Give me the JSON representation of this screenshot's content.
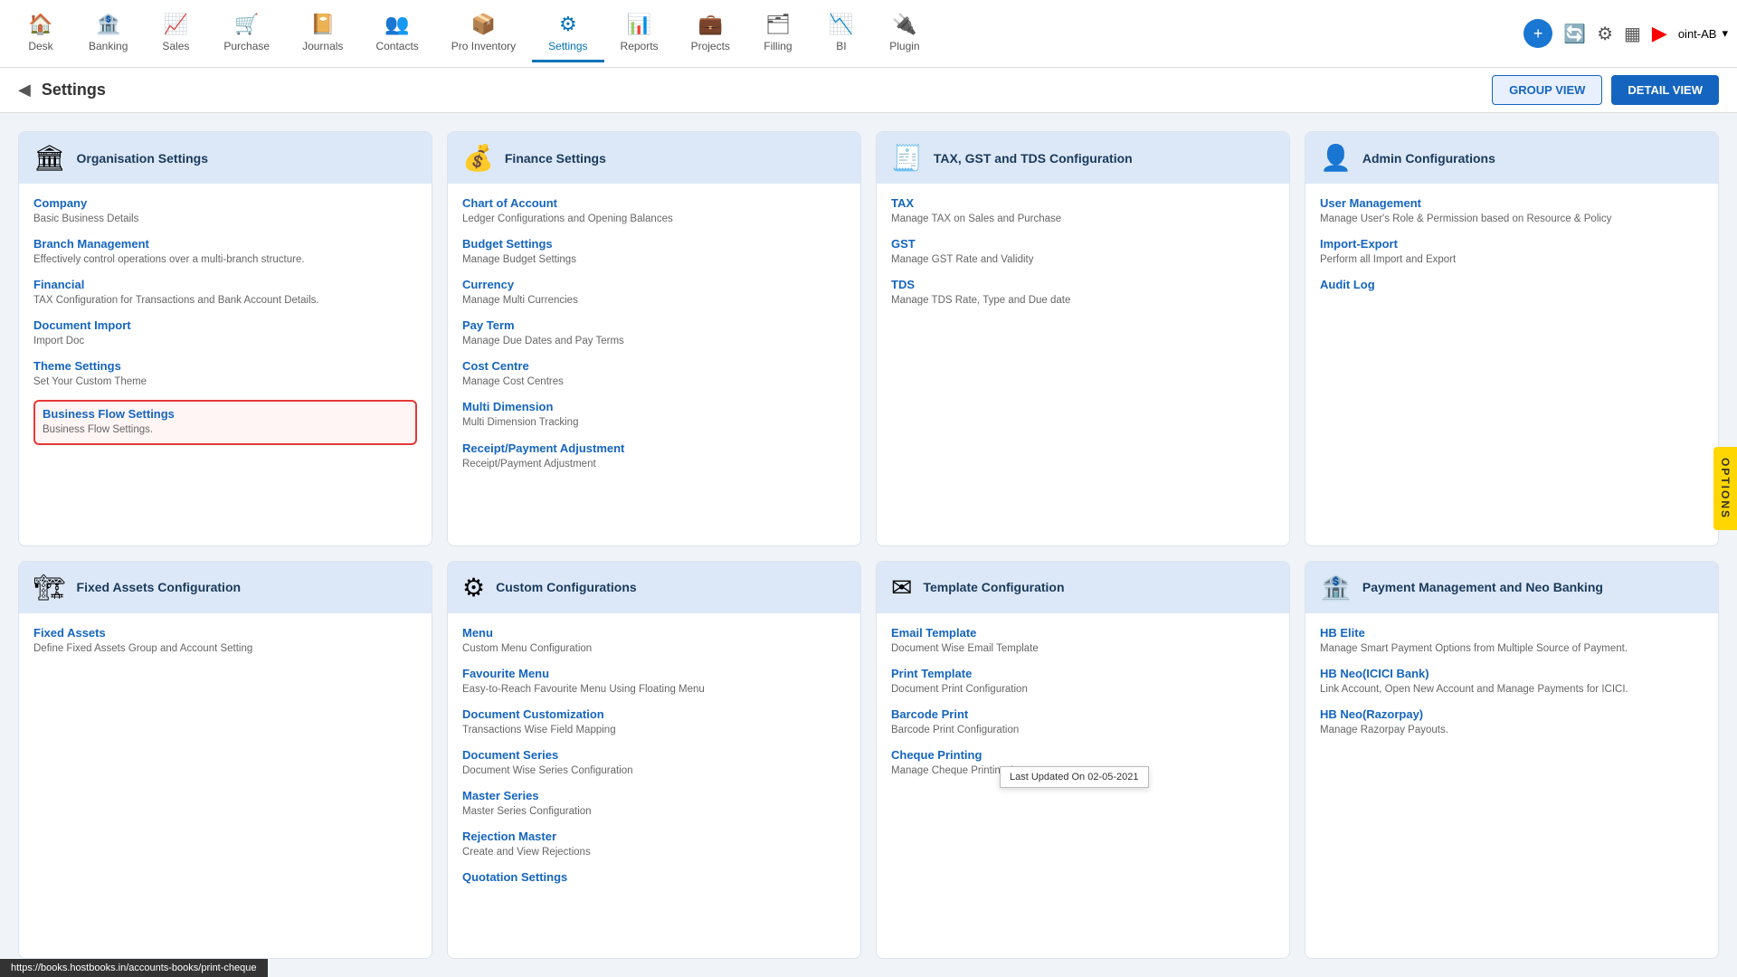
{
  "nav": {
    "items": [
      {
        "label": "Desk",
        "icon": "🏠",
        "active": false
      },
      {
        "label": "Banking",
        "icon": "🏦",
        "active": false
      },
      {
        "label": "Sales",
        "icon": "📈",
        "active": false
      },
      {
        "label": "Purchase",
        "icon": "🛒",
        "active": false
      },
      {
        "label": "Journals",
        "icon": "📔",
        "active": false
      },
      {
        "label": "Contacts",
        "icon": "👥",
        "active": false
      },
      {
        "label": "Pro Inventory",
        "icon": "📦",
        "active": false
      },
      {
        "label": "Settings",
        "icon": "⚙",
        "active": true
      },
      {
        "label": "Reports",
        "icon": "📊",
        "active": false
      },
      {
        "label": "Projects",
        "icon": "💼",
        "active": false
      },
      {
        "label": "Filling",
        "icon": "🗂",
        "active": false
      },
      {
        "label": "BI",
        "icon": "📉",
        "active": false
      },
      {
        "label": "Plugin",
        "icon": "🔌",
        "active": false
      }
    ],
    "user_label": "oint-AB"
  },
  "header": {
    "title": "Settings",
    "btn_group": "GROUP VIEW",
    "btn_detail": "DETAIL VIEW"
  },
  "options_tab": "OPTIONS",
  "cards": {
    "org": {
      "title": "Organisation Settings",
      "icon": "🏛",
      "items": [
        {
          "title": "Company",
          "desc": "Basic Business Details"
        },
        {
          "title": "Branch Management",
          "desc": "Effectively control operations over a multi-branch structure."
        },
        {
          "title": "Financial",
          "desc": "TAX Configuration for Transactions and Bank Account Details."
        },
        {
          "title": "Document Import",
          "desc": "Import Doc"
        },
        {
          "title": "Theme Settings",
          "desc": "Set Your Custom Theme"
        },
        {
          "title": "Business Flow Settings",
          "desc": "Business Flow Settings.",
          "highlighted": true
        }
      ]
    },
    "finance": {
      "title": "Finance Settings",
      "icon": "💰",
      "items": [
        {
          "title": "Chart of Account",
          "desc": "Ledger Configurations and Opening Balances"
        },
        {
          "title": "Budget Settings",
          "desc": "Manage Budget Settings"
        },
        {
          "title": "Currency",
          "desc": "Manage Multi Currencies"
        },
        {
          "title": "Pay Term",
          "desc": "Manage Due Dates and Pay Terms"
        },
        {
          "title": "Cost Centre",
          "desc": "Manage Cost Centres"
        },
        {
          "title": "Multi Dimension",
          "desc": "Multi Dimension Tracking"
        },
        {
          "title": "Receipt/Payment Adjustment",
          "desc": "Receipt/Payment Adjustment"
        }
      ]
    },
    "tax": {
      "title": "TAX, GST and TDS Configuration",
      "icon": "🧾",
      "items": [
        {
          "title": "TAX",
          "desc": "Manage TAX on Sales and Purchase"
        },
        {
          "title": "GST",
          "desc": "Manage GST Rate and Validity"
        },
        {
          "title": "TDS",
          "desc": "Manage TDS Rate, Type and Due date"
        }
      ]
    },
    "admin": {
      "title": "Admin Configurations",
      "icon": "👤",
      "items": [
        {
          "title": "User Management",
          "desc": "Manage User's Role & Permission based on Resource & Policy"
        },
        {
          "title": "Import-Export",
          "desc": "Perform all Import and Export"
        },
        {
          "title": "Audit Log",
          "desc": ""
        }
      ]
    },
    "fixed_assets": {
      "title": "Fixed Assets Configuration",
      "icon": "🏗",
      "items": [
        {
          "title": "Fixed Assets",
          "desc": "Define Fixed Assets Group and Account Setting"
        }
      ]
    },
    "custom": {
      "title": "Custom Configurations",
      "icon": "⚙",
      "items": [
        {
          "title": "Menu",
          "desc": "Custom Menu Configuration"
        },
        {
          "title": "Favourite Menu",
          "desc": "Easy-to-Reach Favourite Menu Using Floating Menu"
        },
        {
          "title": "Document Customization",
          "desc": "Transactions Wise Field Mapping"
        },
        {
          "title": "Document Series",
          "desc": "Document Wise Series Configuration"
        },
        {
          "title": "Master Series",
          "desc": "Master Series Configuration"
        },
        {
          "title": "Rejection Master",
          "desc": "Create and View Rejections"
        },
        {
          "title": "Quotation Settings",
          "desc": ""
        }
      ]
    },
    "template": {
      "title": "Template Configuration",
      "icon": "✉",
      "items": [
        {
          "title": "Email Template",
          "desc": "Document Wise Email Template"
        },
        {
          "title": "Print Template",
          "desc": "Document Print Configuration"
        },
        {
          "title": "Barcode Print",
          "desc": "Barcode Print Configuration"
        },
        {
          "title": "Cheque Printing",
          "desc": "Manage Cheque Printing Accounts",
          "tooltip": "Last Updated On 02-05-2021"
        }
      ]
    },
    "payment": {
      "title": "Payment Management and Neo Banking",
      "icon": "🏦",
      "items": [
        {
          "title": "HB Elite",
          "desc": "Manage Smart Payment Options from Multiple Source of Payment."
        },
        {
          "title": "HB Neo(ICICI Bank)",
          "desc": "Link Account, Open New Account and Manage Payments for ICICI."
        },
        {
          "title": "HB Neo(Razorpay)",
          "desc": "Manage Razorpay Payouts."
        }
      ]
    }
  },
  "status_bar": {
    "url": "https://books.hostbooks.in/accounts-books/print-cheque"
  }
}
